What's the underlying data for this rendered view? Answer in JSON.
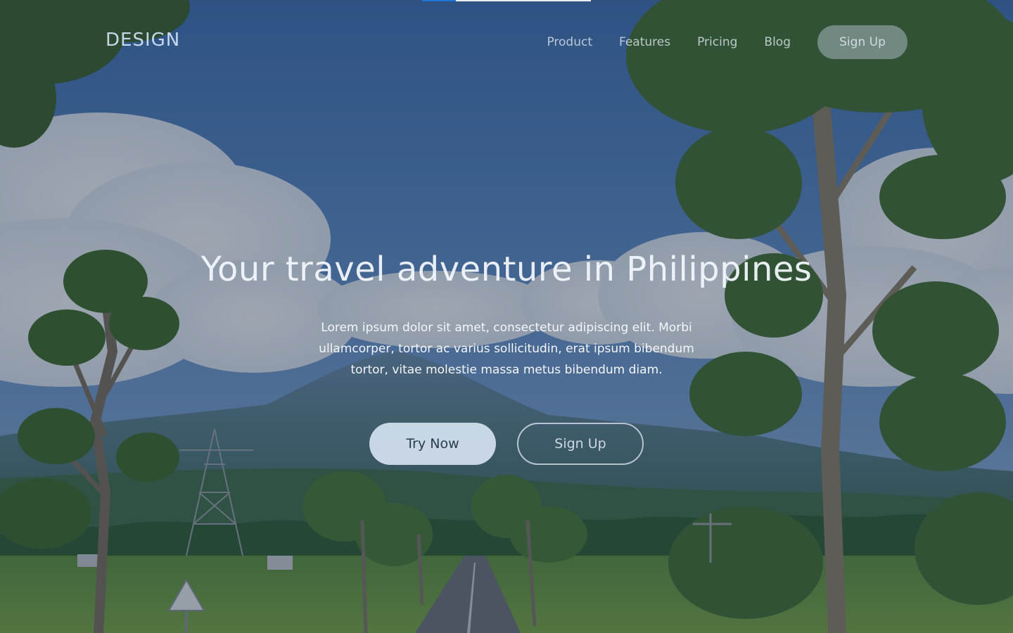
{
  "progress": {
    "value": 0.2,
    "fill_color": "#1f74d8",
    "track_color": "#e9edf3"
  },
  "header": {
    "logo": "DESIGN",
    "nav": {
      "product": "Product",
      "features": "Features",
      "pricing": "Pricing",
      "blog": "Blog",
      "signup": "Sign Up"
    }
  },
  "hero": {
    "title": "Your travel adventure in Philippines",
    "text": "Lorem ipsum dolor sit amet, consectetur adipiscing elit. Morbi ullamcorper, tortor ac varius sollicitudin, erat ipsum bibendum tortor, vitae molestie massa metus bibendum diam.",
    "try_now": "Try Now",
    "sign_up": "Sign Up"
  }
}
